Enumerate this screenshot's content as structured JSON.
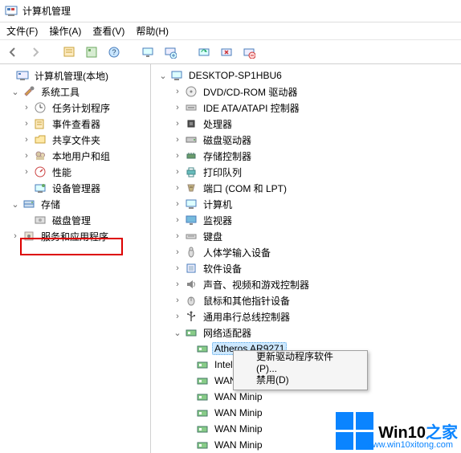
{
  "window": {
    "title": "计算机管理"
  },
  "menu": {
    "file": "文件(F)",
    "action": "操作(A)",
    "view": "查看(V)",
    "help": "帮助(H)"
  },
  "left_tree": {
    "root": "计算机管理(本地)",
    "sys_tools": "系统工具",
    "task_sched": "任务计划程序",
    "event_viewer": "事件查看器",
    "shared_folders": "共享文件夹",
    "local_users": "本地用户和组",
    "performance": "性能",
    "device_mgr": "设备管理器",
    "storage": "存储",
    "disk_mgmt": "磁盘管理",
    "services_apps": "服务和应用程序"
  },
  "device_tree": {
    "root": "DESKTOP-SP1HBU6",
    "dvd": "DVD/CD-ROM 驱动器",
    "ide": "IDE ATA/ATAPI 控制器",
    "cpu": "处理器",
    "disk": "磁盘驱动器",
    "storage_ctrl": "存储控制器",
    "print": "打印队列",
    "ports": "端口 (COM 和 LPT)",
    "computer": "计算机",
    "monitor": "监视器",
    "keyboard": "键盘",
    "hid": "人体学输入设备",
    "softdev": "软件设备",
    "sound": "声音、视频和游戏控制器",
    "mouse": "鼠标和其他指针设备",
    "usb": "通用串行总线控制器",
    "network": "网络适配器",
    "net_items": {
      "atheros": "Atheros AR9271",
      "intel": "Intel(R) 8256",
      "wan1": "WAN Minipo",
      "wan2": "WAN Minip",
      "wan3": "WAN Minip",
      "wan4": "WAN Minip",
      "wan5": "WAN Minip"
    }
  },
  "context_menu": {
    "update": "更新驱动程序软件(P)...",
    "disable": "禁用(D)"
  },
  "watermark": {
    "brand_pre": "Win10",
    "brand_suf": "之家",
    "url": "www.win10xitong.com"
  }
}
